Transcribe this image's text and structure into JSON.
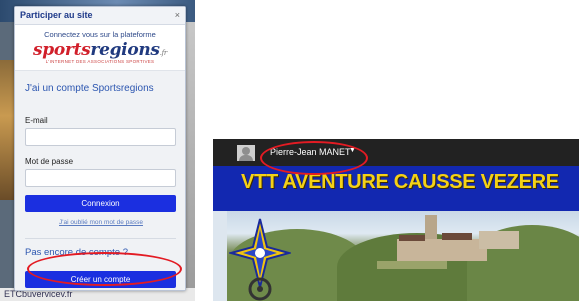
{
  "login_popup": {
    "title": "Participer au site",
    "close_symbol": "×",
    "connect_text": "Connectez vous sur la plateforme",
    "brand": {
      "part1": "sports",
      "part2": "regions",
      "suffix": ".fr"
    },
    "tagline": "L'INTERNET DES ASSOCIATIONS SPORTIVES",
    "account_heading": "J'ai un compte Sportsregions",
    "email_label": "E-mail",
    "email_value": "",
    "password_label": "Mot de passe",
    "password_value": "",
    "login_button": "Connexion",
    "forgot_link": "J'ai oublié mon mot de passe",
    "no_account_heading": "Pas encore de compte ?",
    "create_button": "Créer un compte"
  },
  "background_footer_text": "ETCbuvervicev.fr",
  "site": {
    "user_name": "Pierre-Jean MANET",
    "user_caret": "▼",
    "banner_title": "VTT AVENTURE CAUSSE VEZERE",
    "accent_colors": {
      "banner": "#1228b0",
      "title": "#f4d117",
      "annotation": "#e31b23",
      "button": "#1b2fe0"
    }
  },
  "icons": [
    "close-icon",
    "avatar-icon",
    "caret-down-icon",
    "club-logo"
  ]
}
